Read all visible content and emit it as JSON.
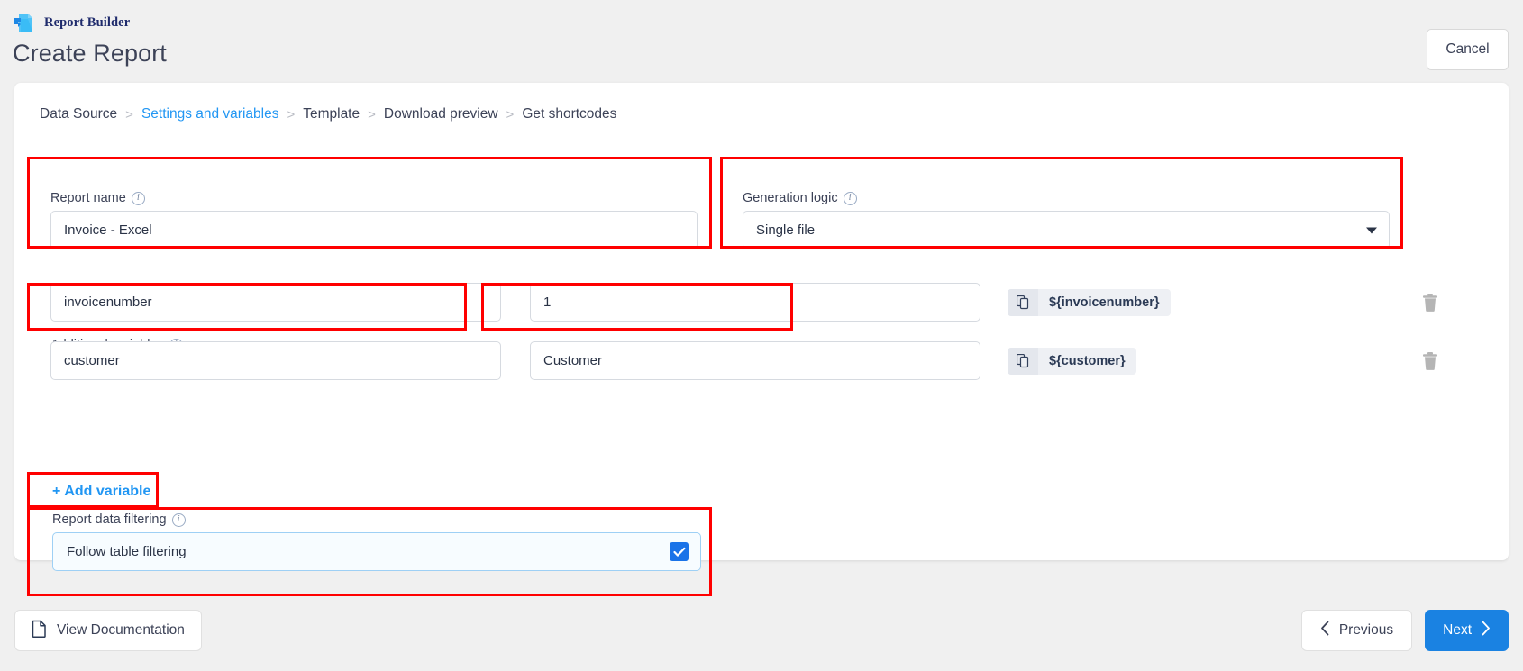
{
  "header": {
    "brand_name": "Report Builder",
    "logo_icon": "report-document-icon",
    "page_title": "Create Report",
    "cancel_label": "Cancel"
  },
  "breadcrumb": {
    "separator": ">",
    "items": [
      {
        "label": "Data Source",
        "active": false
      },
      {
        "label": "Settings and variables",
        "active": true
      },
      {
        "label": "Template",
        "active": false
      },
      {
        "label": "Download preview",
        "active": false
      },
      {
        "label": "Get shortcodes",
        "active": false
      }
    ]
  },
  "form": {
    "report_name": {
      "label": "Report name",
      "info_icon": "info-icon",
      "value": "Invoice - Excel"
    },
    "generation_logic": {
      "label": "Generation logic",
      "info_icon": "info-icon",
      "value": "Single file",
      "dropdown_icon": "chevron-down-icon"
    },
    "additional_variables": {
      "label": "Additional variables",
      "info_icon": "info-icon",
      "add_variable_label": "Add variable",
      "add_variable_plus": "+",
      "copy_icon": "copy-icon",
      "delete_icon": "trash-icon",
      "rows": [
        {
          "name": "invoicenumber",
          "value": "1",
          "shortcode": "${invoicenumber}"
        },
        {
          "name": "customer",
          "value": "Customer",
          "shortcode": "${customer}"
        }
      ]
    },
    "report_data_filtering": {
      "label": "Report data filtering",
      "info_icon": "info-icon",
      "option_label": "Follow table filtering",
      "checked": true,
      "check_icon": "checkmark-icon"
    }
  },
  "footer": {
    "documentation_label": "View Documentation",
    "documentation_icon": "document-icon",
    "previous_label": "Previous",
    "previous_icon": "chevron-left-icon",
    "next_label": "Next",
    "next_icon": "chevron-right-icon"
  },
  "colors": {
    "accent_blue": "#2196f3",
    "primary_button": "#1a82e2",
    "highlight_red": "#ff0000",
    "brand_navy": "#1f2b6c"
  }
}
